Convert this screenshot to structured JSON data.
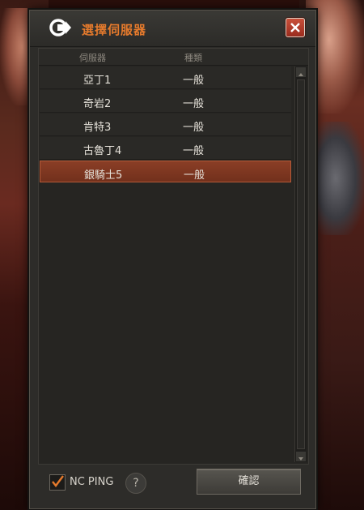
{
  "window": {
    "title": "選擇伺服器",
    "close_icon": "close-icon"
  },
  "list": {
    "columns": {
      "name": "伺服器",
      "type": "種類"
    },
    "rows": [
      {
        "name": "亞丁1",
        "type": "一般",
        "selected": false
      },
      {
        "name": "奇岩2",
        "type": "一般",
        "selected": false
      },
      {
        "name": "肯特3",
        "type": "一般",
        "selected": false
      },
      {
        "name": "古魯丁4",
        "type": "一般",
        "selected": false
      },
      {
        "name": "銀騎士5",
        "type": "一般",
        "selected": true
      }
    ]
  },
  "footer": {
    "ping_label": "NC PING",
    "ping_checked": true,
    "help_glyph": "?",
    "confirm_label": "確認"
  },
  "colors": {
    "accent": "#e57a2c",
    "selected_row": "#7a341f"
  }
}
